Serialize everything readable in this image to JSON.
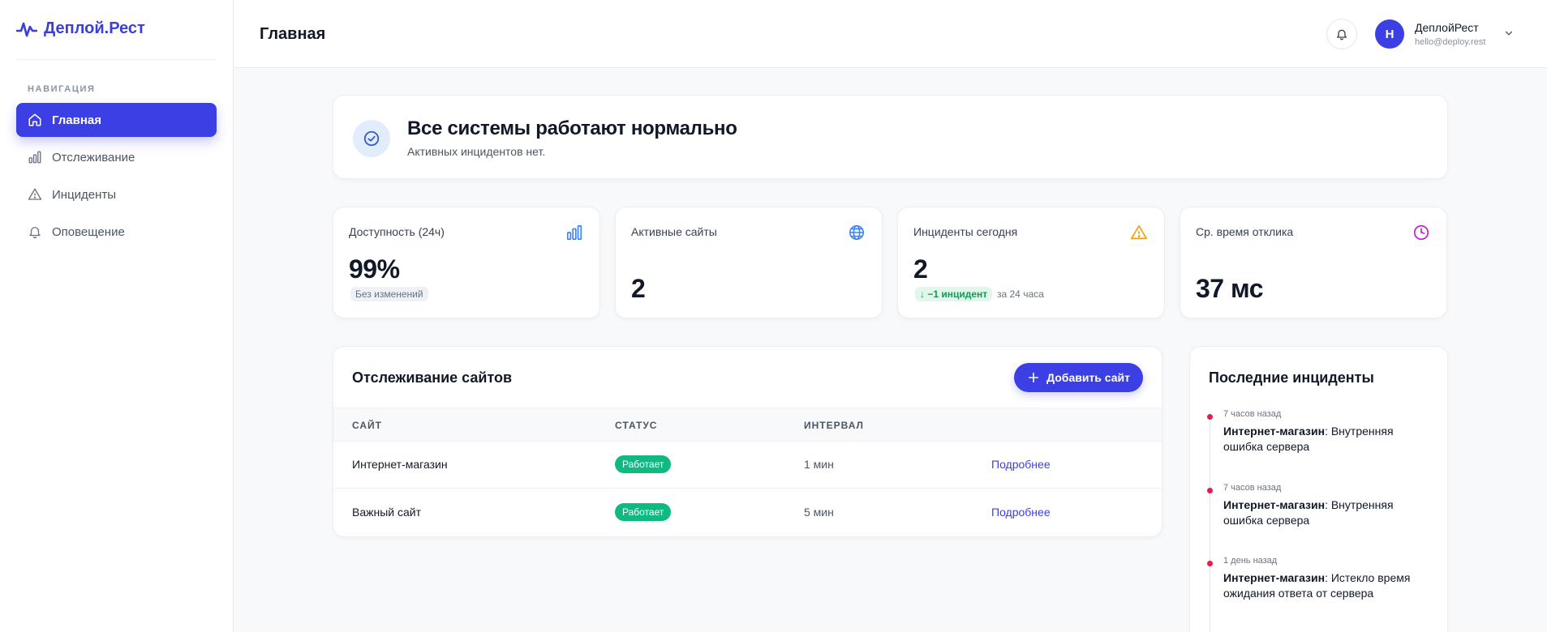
{
  "brand": {
    "name": "Деплой.Рест",
    "accent": "#3b3fe4"
  },
  "sidebar": {
    "heading": "НАВИГАЦИЯ",
    "items": [
      {
        "label": "Главная",
        "icon": "home-icon",
        "active": true
      },
      {
        "label": "Отслеживание",
        "icon": "bar-chart-icon",
        "active": false
      },
      {
        "label": "Инциденты",
        "icon": "warning-icon",
        "active": false
      },
      {
        "label": "Оповещение",
        "icon": "bell-icon",
        "active": false
      }
    ]
  },
  "header": {
    "title": "Главная",
    "user": {
      "initial": "Н",
      "name": "ДеплойРест",
      "email": "hello@deploy.rest"
    }
  },
  "status_banner": {
    "title": "Все системы работают нормально",
    "subtitle": "Активных инцидентов нет.",
    "icon": "check-circle-icon"
  },
  "stats": [
    {
      "label": "Доступность (24ч)",
      "value": "99%",
      "note": "Без изменений",
      "icon": "bar-chart-icon",
      "icon_color": "#3b82f6"
    },
    {
      "label": "Активные сайты",
      "value": "2",
      "icon": "globe-icon",
      "icon_color": "#3b82f6"
    },
    {
      "label": "Инциденты сегодня",
      "value": "2",
      "delta": "↓ −1 инцидент",
      "period": "за 24 часа",
      "icon": "warning-icon",
      "icon_color": "#f59e0b"
    },
    {
      "label": "Ср. время отклика",
      "value": "37 мс",
      "icon": "clock-icon",
      "icon_color": "#c026d3"
    }
  ],
  "monitoring": {
    "title": "Отслеживание сайтов",
    "add_button": "Добавить сайт",
    "columns": [
      "САЙТ",
      "СТАТУС",
      "ИНТЕРВАЛ"
    ],
    "rows": [
      {
        "site": "Интернет-магазин",
        "status": "Работает",
        "interval": "1 мин",
        "link": "Подробнее"
      },
      {
        "site": "Важный сайт",
        "status": "Работает",
        "interval": "5 мин",
        "link": "Подробнее"
      }
    ],
    "status_color": "#10b981"
  },
  "incidents": {
    "title": "Последние инциденты",
    "items": [
      {
        "time": "7 часов назад",
        "site": "Интернет-магазин",
        "message": "Внутренняя ошибка сервера"
      },
      {
        "time": "7 часов назад",
        "site": "Интернет-магазин",
        "message": "Внутренняя ошибка сервера"
      },
      {
        "time": "1 день назад",
        "site": "Интернет-магазин",
        "message": "Истекло время ожидания ответа от сервера"
      }
    ],
    "dot_color": "#e11d48"
  }
}
